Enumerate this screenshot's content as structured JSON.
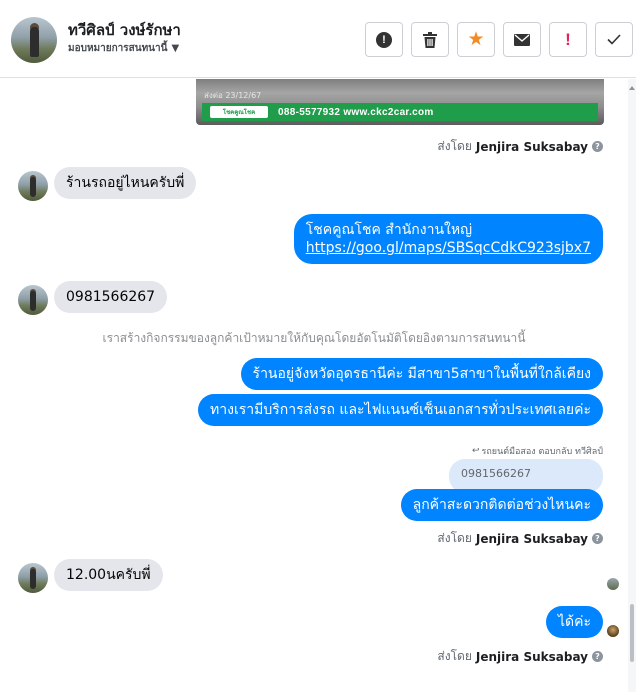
{
  "header": {
    "contact_name": "ทวีศิลป์ วงษ์รักษา",
    "assign_label": "มอบหมายการสนทนานี้",
    "actions": [
      {
        "name": "spam-button",
        "icon": "exclamation-circle-icon"
      },
      {
        "name": "delete-button",
        "icon": "trash-icon"
      },
      {
        "name": "star-button",
        "icon": "star-icon"
      },
      {
        "name": "mark-unread-button",
        "icon": "envelope-icon"
      },
      {
        "name": "follow-up-button",
        "icon": "red-exclamation-icon"
      },
      {
        "name": "mark-done-button",
        "icon": "checkmark-icon"
      }
    ]
  },
  "thread": {
    "ad_image": {
      "date": "ส่งต่อ 23/12/67",
      "logo_text": "โชคคูณโชค",
      "caption": "088-5577932 www.ckc2car.com"
    },
    "sent_by_label": "ส่งโดย",
    "sent_by_name": "Jenjira Suksabay",
    "messages": {
      "in1": "ร้านรถอยู่ไหนครับพี่",
      "out1_line1": "โชคคูณโชค สำนักงานใหญ่",
      "out1_link": "https://goo.gl/maps/SBSqcCdkC923sjbx7",
      "in2": "0981566267",
      "system": "เราสร้างกิจกรรมของลูกค้าเป้าหมายให้กับคุณโดยอัตโนมัติโดยอิงตามการสนทนานี้",
      "out2": "ร้านอยู่จังหวัดอุดรธานีค่ะ มีสาขา5สาขาในพื้นที่ใกล้เคียง",
      "out3": "ทางเรามีบริการส่งรถ และไฟแนนซ์เซ็นเอกสารทั่วประเทศเลยค่ะ",
      "reply_meta": "รถยนต์มือสอง ตอบกลับ ทวีศิลป์",
      "quoted": "0981566267",
      "out4": "ลูกค้าสะดวกติดต่อช่วงไหนคะ",
      "in3": "12.00นครับพี่",
      "out5": "ได้ค่ะ"
    }
  },
  "colors": {
    "accent": "#0084ff",
    "incoming_bubble": "#e4e6eb",
    "star": "#f28b25",
    "follow_up": "#e0245e"
  }
}
